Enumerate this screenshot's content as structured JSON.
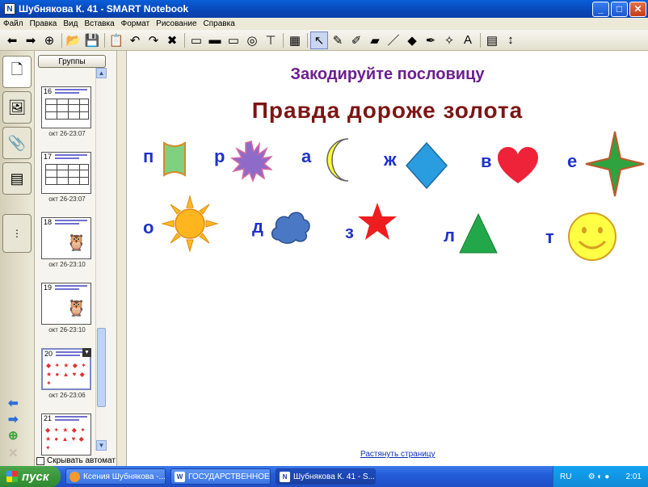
{
  "window": {
    "title": "Шубнякова К. 41 - SMART Notebook",
    "app_icon": "smart-notebook-icon",
    "minimize": "_",
    "maximize": "□",
    "close": "✕"
  },
  "menu": [
    "Файл",
    "Правка",
    "Вид",
    "Вставка",
    "Формат",
    "Рисование",
    "Справка"
  ],
  "toolbar": {
    "icons": [
      "back-arrow-icon",
      "forward-arrow-icon",
      "add-page-icon",
      "open-folder-icon",
      "save-icon",
      "paste-icon",
      "undo-icon",
      "redo-icon",
      "delete-icon",
      "screen-shade-icon",
      "full-screen-icon",
      "dual-page-icon",
      "screen-capture-icon",
      "toggle-toolbar-icon",
      "table-icon",
      "select-pointer-icon",
      "pen-icon",
      "creative-pen-icon",
      "eraser-icon",
      "line-icon",
      "shapes-icon",
      "magic-pen-icon",
      "fill-icon",
      "text-icon",
      "properties-icon",
      "move-toolbar-icon"
    ],
    "glyphs": [
      "⬅",
      "➡",
      "⊕",
      "📂",
      "💾",
      "📋",
      "↶",
      "↷",
      "✖",
      "▭",
      "▬",
      "▭",
      "◎",
      "⊤",
      "▦",
      "↖",
      "✎",
      "✐",
      "▰",
      "／",
      "◆",
      "✒",
      "✧",
      "A",
      "▤",
      "↕"
    ]
  },
  "left_tabs": [
    "page-sorter-tab-icon",
    "gallery-tab-icon",
    "attachments-tab-icon",
    "properties-tab-icon"
  ],
  "left_tab_glyphs": [
    "🗋",
    "🖼",
    "📎",
    "▤"
  ],
  "sorter": {
    "groups_button": "Группы",
    "pages": [
      {
        "num": "16",
        "date": "окт 26-23:07",
        "kind": "table"
      },
      {
        "num": "17",
        "date": "окт 26-23:07",
        "kind": "table"
      },
      {
        "num": "18",
        "date": "окт 26-23:10",
        "kind": "owl"
      },
      {
        "num": "19",
        "date": "окт 26-23:10",
        "kind": "owl"
      },
      {
        "num": "20",
        "date": "окт 26-23:06",
        "kind": "shapes",
        "selected": true
      },
      {
        "num": "21",
        "date": "",
        "kind": "shapes"
      }
    ],
    "auto_hide": "Скрывать автомат",
    "scroll_up": "▲",
    "scroll_down": "▼"
  },
  "nav": {
    "prev": "⬅",
    "next": "➡",
    "add": "⊕",
    "delete": "✕"
  },
  "canvas": {
    "heading": "Закодируйте пословицу",
    "proverb": "Правда дороже золота",
    "letters": [
      "п",
      "р",
      "а",
      "ж",
      "в",
      "е",
      "о",
      "д",
      "з",
      "л",
      "т"
    ],
    "shape_names": [
      "banner-shape",
      "starburst-shape",
      "crescent-shape",
      "diamond-shape",
      "heart-shape",
      "four-point-star-shape",
      "sun-shape",
      "cloud-shape",
      "star-shape",
      "triangle-shape",
      "smiley-shape"
    ],
    "colors": {
      "heading": "#6b1f8f",
      "proverb": "#7d1515",
      "letters": "#1f32c9"
    },
    "extend_link": "Растянуть страницу"
  },
  "taskbar": {
    "start": "пуск",
    "tasks": [
      {
        "label": "Ксения Шубнякова -...",
        "icon": "firefox-icon"
      },
      {
        "label": "ГОСУДАРСТВЕННОЕ...",
        "icon": "word-icon"
      },
      {
        "label": "Шубнякова К. 41 - S...",
        "icon": "smart-notebook-icon",
        "active": true
      }
    ],
    "lang": "RU",
    "clock": "2:01"
  }
}
